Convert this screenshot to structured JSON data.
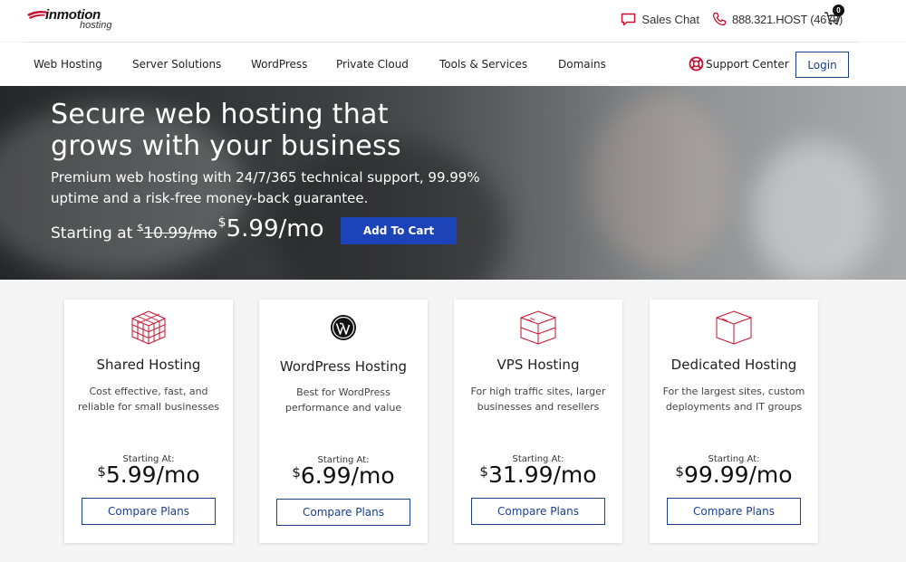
{
  "brand": {
    "logo_text": "inmotion",
    "logo_sub": "hosting",
    "accent_color": "#1d43b8",
    "logo_red": "#c8102e"
  },
  "topbar": {
    "sales_chat": "Sales Chat",
    "phone": "888.321.HOST (4678)",
    "cart_count": "0"
  },
  "nav": {
    "items": [
      {
        "label": "Web Hosting"
      },
      {
        "label": "Server Solutions"
      },
      {
        "label": "WordPress"
      },
      {
        "label": "Private Cloud"
      },
      {
        "label": "Tools & Services"
      },
      {
        "label": "Domains"
      }
    ],
    "support": "Support Center",
    "login": "Login"
  },
  "hero": {
    "title_line1": "Secure web hosting that",
    "title_line2": "grows with your business",
    "sub_line1": "Premium web hosting with 24/7/365 technical support, 99.99%",
    "sub_line2": "uptime and a risk-free money-back guarantee.",
    "starting_at": "Starting at",
    "currency": "$",
    "old_price": "10.99/mo",
    "new_price": "5.99/mo",
    "cta": "Add To Cart"
  },
  "cards": [
    {
      "icon": "cube-grid-icon",
      "title": "Shared Hosting",
      "desc": "Cost effective, fast, and reliable for small businesses",
      "starting": "Starting At:",
      "currency": "$",
      "price": "5.99/mo",
      "button": "Compare Plans"
    },
    {
      "icon": "wordpress-icon",
      "title": "WordPress Hosting",
      "desc": "Best for WordPress performance and value",
      "starting": "Starting At:",
      "currency": "$",
      "price": "6.99/mo",
      "button": "Compare Plans"
    },
    {
      "icon": "server-stack-icon",
      "title": "VPS Hosting",
      "desc": "For high traffic sites, larger businesses and resellers",
      "starting": "Starting At:",
      "currency": "$",
      "price": "31.99/mo",
      "button": "Compare Plans"
    },
    {
      "icon": "cube-icon",
      "title": "Dedicated Hosting",
      "desc": "For the largest sites, custom deployments and IT groups",
      "starting": "Starting At:",
      "currency": "$",
      "price": "99.99/mo",
      "button": "Compare Plans"
    }
  ]
}
